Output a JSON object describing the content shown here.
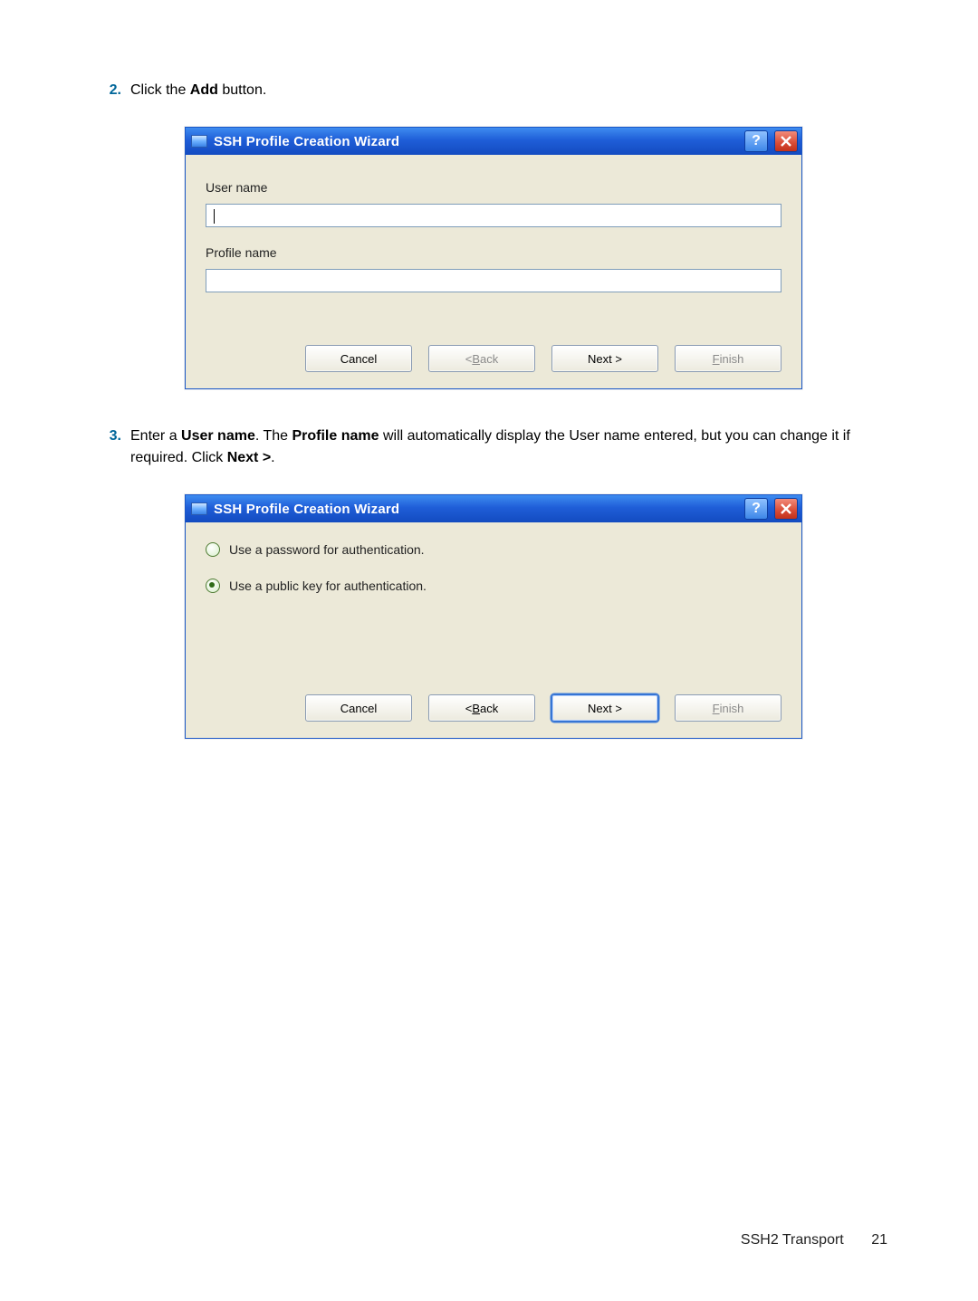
{
  "steps": {
    "s2": {
      "num": "2.",
      "prefix": "Click the ",
      "bold": "Add",
      "suffix": " button."
    },
    "s3": {
      "num": "3.",
      "p1": "Enter a ",
      "b1": "User name",
      "p2": ". The ",
      "b2": "Profile name",
      "p3": " will automatically display the User name entered, but you can change it if required. Click ",
      "b3": "Next >",
      "p4": "."
    }
  },
  "dialog": {
    "title": "SSH Profile Creation Wizard",
    "help_glyph": "?",
    "labels": {
      "user_name": "User name",
      "profile_name": "Profile name"
    },
    "inputs": {
      "user_name_value": "",
      "profile_name_value": ""
    },
    "radios": {
      "password": "Use a password for authentication.",
      "publickey": "Use a public key for authentication."
    },
    "radio_selected": "publickey",
    "buttons": {
      "cancel": "Cancel",
      "back_pre": "< ",
      "back_m": "B",
      "back_post": "ack",
      "next": "Next >",
      "finish_m": "F",
      "finish_post": "inish"
    }
  },
  "footer": {
    "section": "SSH2 Transport",
    "page": "21"
  }
}
